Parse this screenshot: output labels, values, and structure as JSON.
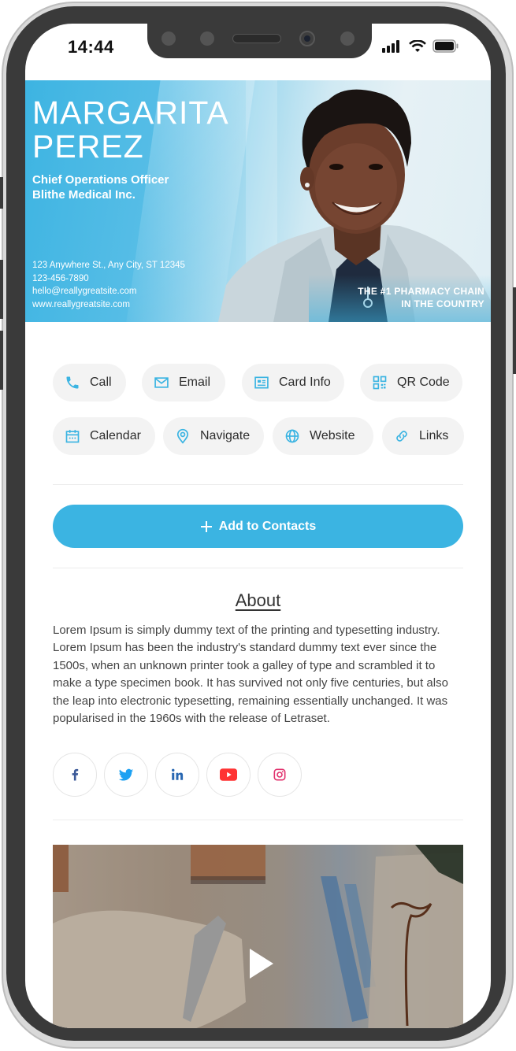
{
  "status_bar": {
    "time": "14:44",
    "icons": [
      "cellular-signal-icon",
      "wifi-icon",
      "battery-icon"
    ]
  },
  "banner": {
    "name_line1": "MARGARITA",
    "name_line2": "PEREZ",
    "job_title": "Chief Operations Officer",
    "company": "Blithe Medical Inc.",
    "address": "123 Anywhere St., Any City, ST 12345",
    "phone": "123-456-7890",
    "email": "hello@reallygreatsite.com",
    "website": "www.reallygreatsite.com",
    "tagline_line1": "THE #1 PHARMACY CHAIN",
    "tagline_line2": "IN THE COUNTRY"
  },
  "actions": [
    {
      "label": "Call",
      "icon": "phone-icon"
    },
    {
      "label": "Email",
      "icon": "envelope-icon"
    },
    {
      "label": "Card Info",
      "icon": "id-card-icon"
    },
    {
      "label": "QR Code",
      "icon": "qr-code-icon"
    },
    {
      "label": "Calendar",
      "icon": "calendar-icon"
    },
    {
      "label": "Navigate",
      "icon": "map-pin-icon"
    },
    {
      "label": "Website",
      "icon": "globe-icon"
    },
    {
      "label": "Links",
      "icon": "link-icon"
    }
  ],
  "add_contacts": {
    "label": "Add to Contacts",
    "icon": "plus-icon"
  },
  "about": {
    "title": "About",
    "text": "Lorem Ipsum is simply dummy text of the printing and typesetting industry. Lorem Ipsum has been the industry's standard dummy text ever since the 1500s, when an unknown printer took a galley of type and scrambled it to make a type specimen book. It has survived not only five centuries, but also the leap into electronic typesetting, remaining essentially unchanged. It was popularised in the 1960s with the release of Letraset."
  },
  "social": [
    {
      "name": "Facebook",
      "icon": "facebook-icon",
      "color": "#3b5998"
    },
    {
      "name": "Twitter",
      "icon": "twitter-icon",
      "color": "#1da1f2"
    },
    {
      "name": "LinkedIn",
      "icon": "linkedin-icon",
      "color": "#2867b2"
    },
    {
      "name": "YouTube",
      "icon": "youtube-icon",
      "color": "#ff3333"
    },
    {
      "name": "Instagram",
      "icon": "instagram-icon",
      "color": "#e1306c"
    }
  ],
  "video": {
    "icon": "play-icon"
  },
  "colors": {
    "accent": "#3bb4e2",
    "chip_bg": "#f3f3f3",
    "text": "#444444"
  }
}
